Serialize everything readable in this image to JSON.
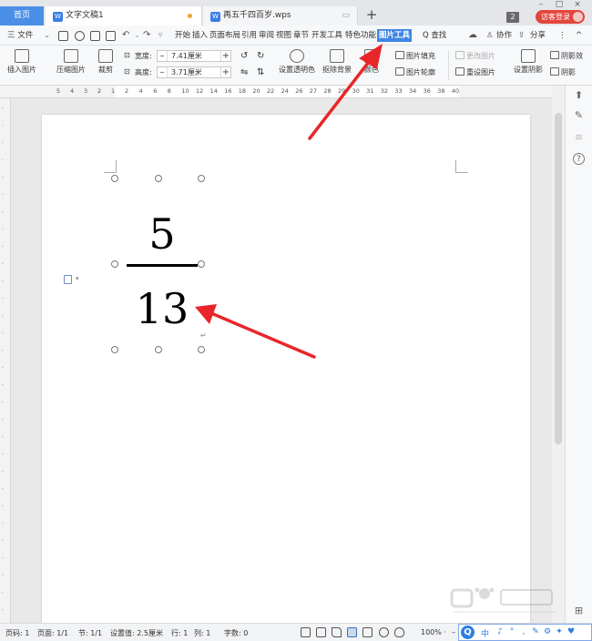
{
  "titlebar": {
    "home_tab": "首页",
    "tabs": [
      {
        "label": "文字文稿1",
        "icon": "W",
        "modified": true
      },
      {
        "label": "再五千四百岁.wps",
        "icon": "W",
        "modified": false
      }
    ],
    "new_tab": "+",
    "window_count": "2",
    "visitor_login": "访客登录",
    "win_controls": [
      "–",
      "□",
      "×"
    ]
  },
  "menubar": {
    "file": "三 文件",
    "file_caret": "⌄",
    "items": [
      "开始",
      "插入",
      "页面布局",
      "引用",
      "审阅",
      "视图",
      "章节",
      "开发工具",
      "特色功能"
    ],
    "active_tab": "图片工具",
    "search": "Q 查找",
    "collaborate": "协作",
    "share": "分享",
    "more": "⋮",
    "collapse": "^"
  },
  "ribbon": {
    "insert_picture": "插入图片",
    "compress_picture": "压缩图片",
    "crop": "裁剪",
    "width_label": "宽度:",
    "width_value": "7.41厘米",
    "height_label": "高度:",
    "height_value": "3.71厘米",
    "spin_minus": "–",
    "spin_plus": "+",
    "set_transparent": "设置透明色",
    "remove_bg": "抠除背景",
    "color": "颜色",
    "picture_fill": "图片填充",
    "picture_outline": "图片轮廓",
    "change_picture": "更改图片",
    "reset_picture": "重设图片",
    "set_shadow": "设置阴影",
    "shadow_effect": "阴影效",
    "shadow_2": "阴影"
  },
  "ruler": {
    "top_left": [
      "5",
      "4",
      "3",
      "2",
      "1"
    ],
    "top_right": [
      "2",
      "4",
      "6",
      "8",
      "10",
      "12",
      "14",
      "16",
      "18",
      "20",
      "22",
      "24",
      "26",
      "27",
      "28",
      "29",
      "30",
      "31",
      "32",
      "33",
      "34",
      "36",
      "38",
      "40"
    ]
  },
  "document": {
    "numerator": "5",
    "denominator": "13",
    "para_mark": "↵"
  },
  "statusbar": {
    "page_num": "页码: 1",
    "pages": "页面: 1/1",
    "section": "节: 1/1",
    "setting": "设置值: 2.5厘米",
    "row": "行: 1",
    "col": "列: 1",
    "word_count": "字数: 0",
    "zoom": "100% ·",
    "zoom_minus": "–"
  },
  "ime": {
    "logo": "Q",
    "lang": "中",
    "glyphs": [
      "♪",
      "°",
      ",",
      "✎",
      "⚙",
      "✦",
      "♥"
    ]
  },
  "sidepanel": {
    "items": [
      "⬆",
      "✎",
      "≡",
      "?",
      "⊞"
    ]
  },
  "colors": {
    "accent": "#3e86e6",
    "home_tab": "#4a8fe7",
    "visitor": "#e2463c",
    "arrow": "#e8262a"
  }
}
